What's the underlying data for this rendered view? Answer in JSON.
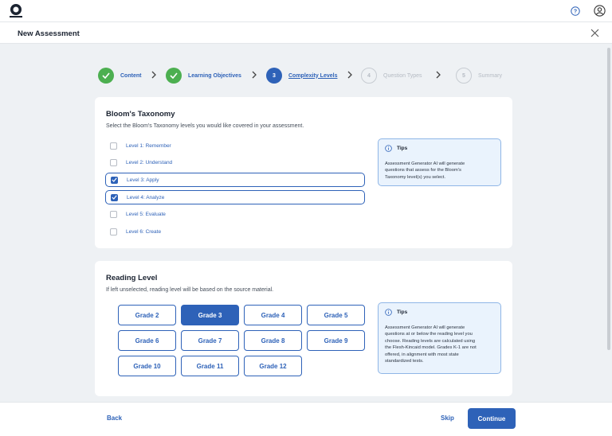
{
  "header": {
    "logo_icon": "discovery-education-logo",
    "help_icon": "help-circle-icon",
    "account_icon": "user-account-icon"
  },
  "dialog": {
    "title": "New Assessment",
    "close_icon": "close-icon"
  },
  "stepper": {
    "steps": [
      {
        "number": "",
        "label": "Content",
        "state": "done"
      },
      {
        "number": "",
        "label": "Learning Objectives",
        "state": "done"
      },
      {
        "number": "3",
        "label": "Complexity Levels",
        "state": "active"
      },
      {
        "number": "4",
        "label": "Question Types",
        "state": "todo"
      },
      {
        "number": "5",
        "label": "Summary",
        "state": "todo"
      }
    ]
  },
  "blooms": {
    "title": "Bloom's Taxonomy",
    "subtitle": "Select the Bloom's Taxonomy levels you would like covered in your assessment.",
    "options": [
      {
        "label": "Level 1: Remember",
        "checked": false
      },
      {
        "label": "Level 2: Understand",
        "checked": false
      },
      {
        "label": "Level 3: Apply",
        "checked": true
      },
      {
        "label": "Level 4: Analyze",
        "checked": true
      },
      {
        "label": "Level 5: Evaluate",
        "checked": false
      },
      {
        "label": "Level 6: Create",
        "checked": false
      }
    ],
    "tips": {
      "title": "Tips",
      "lines": [
        "Assessment Generator AI will generate",
        "questions that assess for the Bloom's",
        "Taxonomy level(s) you select."
      ]
    }
  },
  "reading": {
    "title": "Reading Level",
    "subtitle": "If left unselected, reading level will be based on the source material.",
    "grades": [
      {
        "label": "Grade 2",
        "selected": false
      },
      {
        "label": "Grade 3",
        "selected": true
      },
      {
        "label": "Grade 4",
        "selected": false
      },
      {
        "label": "Grade 5",
        "selected": false
      },
      {
        "label": "Grade 6",
        "selected": false
      },
      {
        "label": "Grade 7",
        "selected": false
      },
      {
        "label": "Grade 8",
        "selected": false
      },
      {
        "label": "Grade 9",
        "selected": false
      },
      {
        "label": "Grade 10",
        "selected": false
      },
      {
        "label": "Grade 11",
        "selected": false
      },
      {
        "label": "Grade 12",
        "selected": false
      }
    ],
    "tips": {
      "title": "Tips",
      "lines": [
        "Assessment Generator AI will generate",
        "questions at or below the reading level you",
        "choose. Reading levels are calculated using",
        "the Flesh-Kincaid model. Grades K-1 are not",
        "offered, in alignment with most state",
        "standardized tests."
      ]
    }
  },
  "footer": {
    "back_label": "Back",
    "skip_label": "Skip",
    "continue_label": "Continue"
  },
  "colors": {
    "accent": "#2e62b8",
    "done": "#4caf50",
    "background": "#eef1f4",
    "tips_bg": "#eaf3fd"
  }
}
